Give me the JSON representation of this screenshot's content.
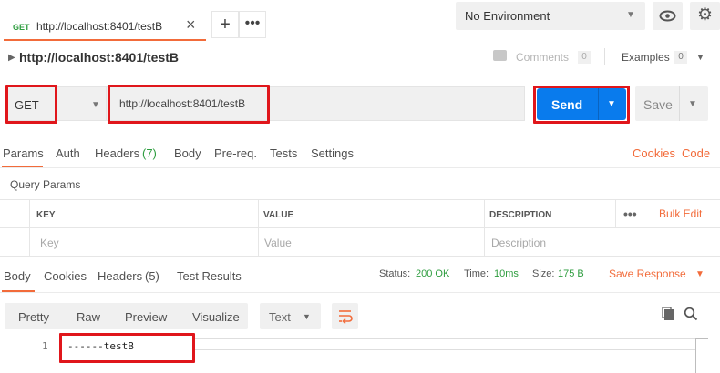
{
  "tab": {
    "method": "GET",
    "url": "http://localhost:8401/testB"
  },
  "environment": {
    "selected": "No Environment"
  },
  "request": {
    "title": "http://localhost:8401/testB",
    "comments_label": "Comments",
    "comments_count": "0",
    "examples_label": "Examples",
    "examples_count": "0",
    "method": "GET",
    "url": "http://localhost:8401/testB",
    "send_label": "Send",
    "save_label": "Save"
  },
  "request_tabs": {
    "params": "Params",
    "auth": "Auth",
    "headers": "Headers",
    "headers_count": "(7)",
    "body": "Body",
    "prereq": "Pre-req.",
    "tests": "Tests",
    "settings": "Settings",
    "cookies": "Cookies",
    "code": "Code"
  },
  "query_params": {
    "title": "Query Params",
    "headers": {
      "key": "KEY",
      "value": "VALUE",
      "description": "DESCRIPTION"
    },
    "placeholders": {
      "key": "Key",
      "value": "Value",
      "description": "Description"
    },
    "bulk_edit": "Bulk Edit"
  },
  "response": {
    "tabs": {
      "body": "Body",
      "cookies": "Cookies",
      "headers": "Headers",
      "headers_count": "(5)",
      "test_results": "Test Results"
    },
    "status_label": "Status:",
    "status_value": "200 OK",
    "time_label": "Time:",
    "time_value": "10ms",
    "size_label": "Size:",
    "size_value": "175 B",
    "save_response": "Save Response",
    "views": [
      "Pretty",
      "Raw",
      "Preview",
      "Visualize"
    ],
    "format": "Text",
    "lines": [
      {
        "num": "1",
        "text": "------testB"
      }
    ]
  },
  "colors": {
    "accent": "#f26b3a",
    "send": "#097bed",
    "success": "#2e9d3f",
    "highlight": "#e0161b"
  }
}
